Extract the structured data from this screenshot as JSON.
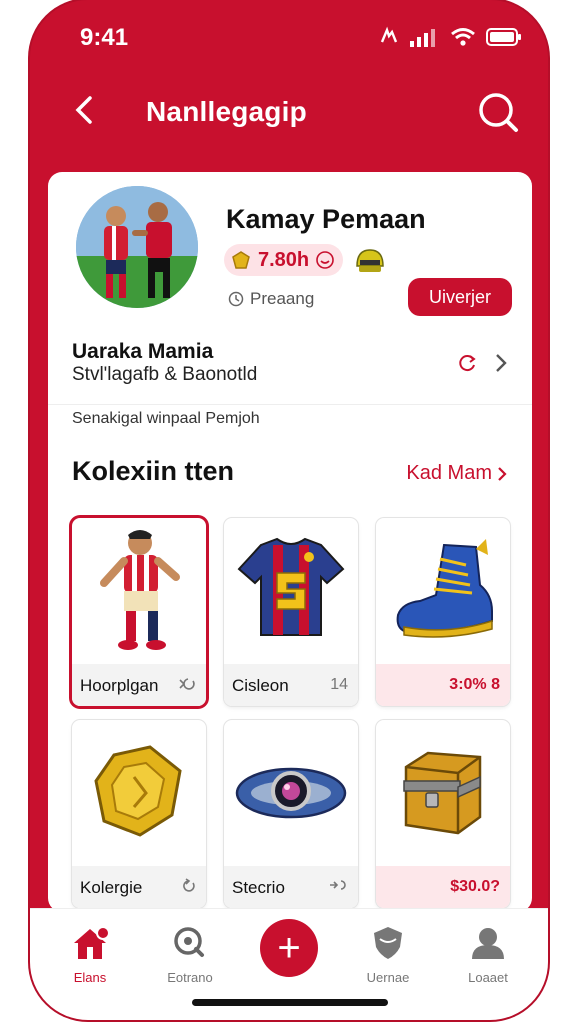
{
  "status": {
    "time": "9:41"
  },
  "header": {
    "title": "Nanllegagip"
  },
  "profile": {
    "name": "Kamay Pemaan",
    "coins": "7.80h",
    "status_label": "Preaang",
    "cta_label": "Uiverjer"
  },
  "team": {
    "name": "Uaraka Mamia",
    "subtitle": "Stvl'lagafb & Baonotld"
  },
  "hint": "Senakigal winpaal Pemjoh",
  "collection": {
    "title": "Kolexiin tten",
    "see_all": "Kad Mam",
    "items": [
      {
        "name": "Hoorplgan",
        "value": "",
        "icon": "player-figure-icon"
      },
      {
        "name": "Cisleon",
        "value": "14",
        "icon": "jersey-icon"
      },
      {
        "name": "",
        "value": "3:0% 8",
        "icon": "boot-icon"
      },
      {
        "name": "Kolergie",
        "value": "",
        "icon": "gold-badge-icon"
      },
      {
        "name": "Stecrio",
        "value": "",
        "icon": "bracelet-icon"
      },
      {
        "name": "",
        "value": "$30.0?",
        "icon": "treasure-chest-icon"
      }
    ]
  },
  "tabs": [
    {
      "label": "Elans",
      "icon": "home-icon",
      "active": true
    },
    {
      "label": "Eotrano",
      "icon": "search-icon",
      "active": false
    },
    {
      "label": "+",
      "icon": "add-icon",
      "active": false
    },
    {
      "label": "Uernae",
      "icon": "shield-icon",
      "active": false
    },
    {
      "label": "Loaaet",
      "icon": "profile-icon",
      "active": false
    }
  ],
  "colors": {
    "brand": "#c8102e",
    "gold": "#e2b31a"
  }
}
